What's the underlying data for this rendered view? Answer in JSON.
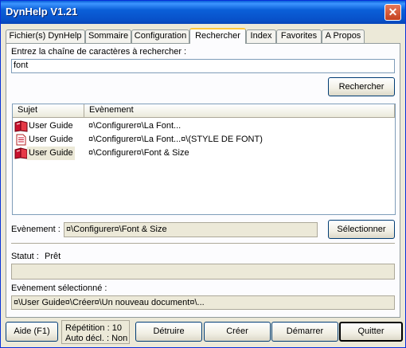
{
  "window": {
    "title": "DynHelp V1.21"
  },
  "tabs": [
    {
      "label": "Fichier(s) DynHelp"
    },
    {
      "label": "Sommaire"
    },
    {
      "label": "Configuration"
    },
    {
      "label": "Rechercher"
    },
    {
      "label": "Index"
    },
    {
      "label": "Favorites"
    },
    {
      "label": "A Propos"
    }
  ],
  "search": {
    "prompt": "Entrez la chaîne de caractères à rechercher :",
    "value": "font",
    "button": "Rechercher"
  },
  "results": {
    "columns": [
      "Sujet",
      "Evènement"
    ],
    "rows": [
      {
        "icon": "book-icon",
        "sujet": "User Guide",
        "evenement": "¤\\Configurer¤\\La Font..."
      },
      {
        "icon": "document-icon",
        "sujet": "User Guide",
        "evenement": "¤\\Configurer¤\\La Font...¤\\(STYLE DE FONT)"
      },
      {
        "icon": "book-icon",
        "sujet": "User Guide",
        "evenement": "¤\\Configurer¤\\Font & Size"
      }
    ]
  },
  "evenement": {
    "label": "Evènement :",
    "value": "¤\\Configurer¤\\Font & Size",
    "button": "Sélectionner"
  },
  "statut": {
    "label": "Statut :",
    "value": "Prêt"
  },
  "selected": {
    "label": "Evènement sélectionné :",
    "value": "¤\\User Guide¤\\Créer¤\\Un nouveau document¤\\..."
  },
  "footer": {
    "aide": "Aide  (F1)",
    "repetition": "Répétition : 10",
    "autodecl": "Auto décl. : Non",
    "detruire": "Détruire",
    "creer": "Créer",
    "demarrer": "Démarrer",
    "quitter": "Quitter"
  }
}
